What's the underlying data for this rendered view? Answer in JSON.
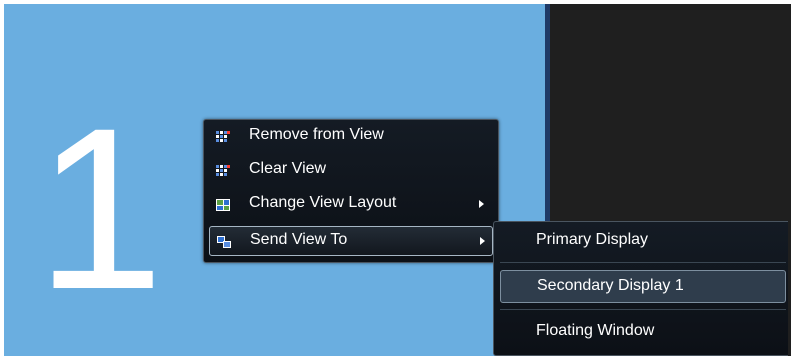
{
  "view": {
    "number": "1",
    "background_color": "#6aaee0"
  },
  "context_menu": {
    "items": [
      {
        "label": "Remove from View",
        "icon": "grid-view-icon"
      },
      {
        "label": "Clear View",
        "icon": "grid-view-icon"
      },
      {
        "label": "Change View Layout",
        "icon": "layout-icon",
        "has_submenu": true
      },
      {
        "label": "Send View To",
        "icon": "send-display-icon",
        "has_submenu": true,
        "selected": true
      }
    ]
  },
  "submenu": {
    "items": [
      {
        "label": "Primary Display"
      },
      {
        "label": "Secondary Display 1",
        "selected": true
      },
      {
        "label": "Floating Window"
      }
    ]
  },
  "colors": {
    "menu_background": "#111820",
    "selection_border": "#a6b6c4",
    "accent": "#1f3a67"
  }
}
